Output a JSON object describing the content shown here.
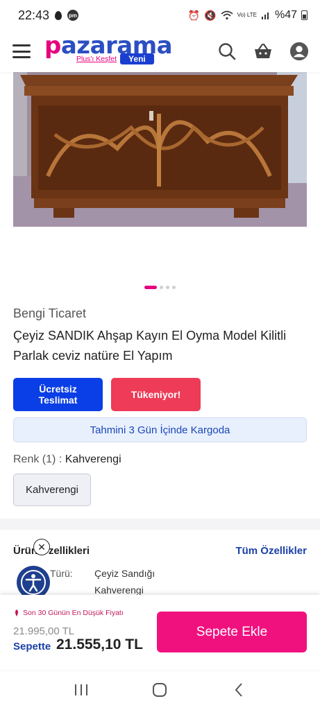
{
  "status_bar": {
    "time": "22:43",
    "app_badge": "pm",
    "network": "Vo) LTE",
    "battery": "%47"
  },
  "header": {
    "logo_part1": "p",
    "logo_part2": "azarama",
    "plus_link": "Plus'ı Keşfet",
    "new_badge": "Yeni",
    "icons": [
      "menu-icon",
      "search-icon",
      "basket-icon",
      "account-icon"
    ]
  },
  "gallery": {
    "image_count": 4,
    "active_index": 0
  },
  "product": {
    "seller": "Bengi Ticaret",
    "title": "Çeyiz SANDIK Ahşap Kayın El Oyma Model Kilitli Parlak ceviz natüre El Yapım",
    "badge_shipping": "Ücretsiz Teslimat",
    "badge_stock": "Tükeniyor!",
    "shipping_estimate": "Tahmini 3 Gün İçinde Kargoda",
    "color_label": "Renk (1) : ",
    "color_value": "Kahverengi",
    "color_option": "Kahverengi"
  },
  "features": {
    "title": "Ürün Özellikleri",
    "all_link": "Tüm Özellikler",
    "rows": [
      {
        "label": "Türü:",
        "value": "Çeyiz Sandığı"
      },
      {
        "label": "",
        "value": "Kahverengi"
      }
    ]
  },
  "buy": {
    "lowest_text": "Son 30 Günün En Düşük Fiyatı",
    "old_price": "21.995,00 TL",
    "cart_label": "Sepette",
    "cart_price": "21.555,10 TL",
    "add_button": "Sepete Ekle"
  },
  "colors": {
    "brand_pink": "#e6007e",
    "brand_blue": "#2b4fc2",
    "free_shipping": "#0a3ee6",
    "sold_out": "#ee3b58",
    "add_to_cart": "#f0117f"
  }
}
